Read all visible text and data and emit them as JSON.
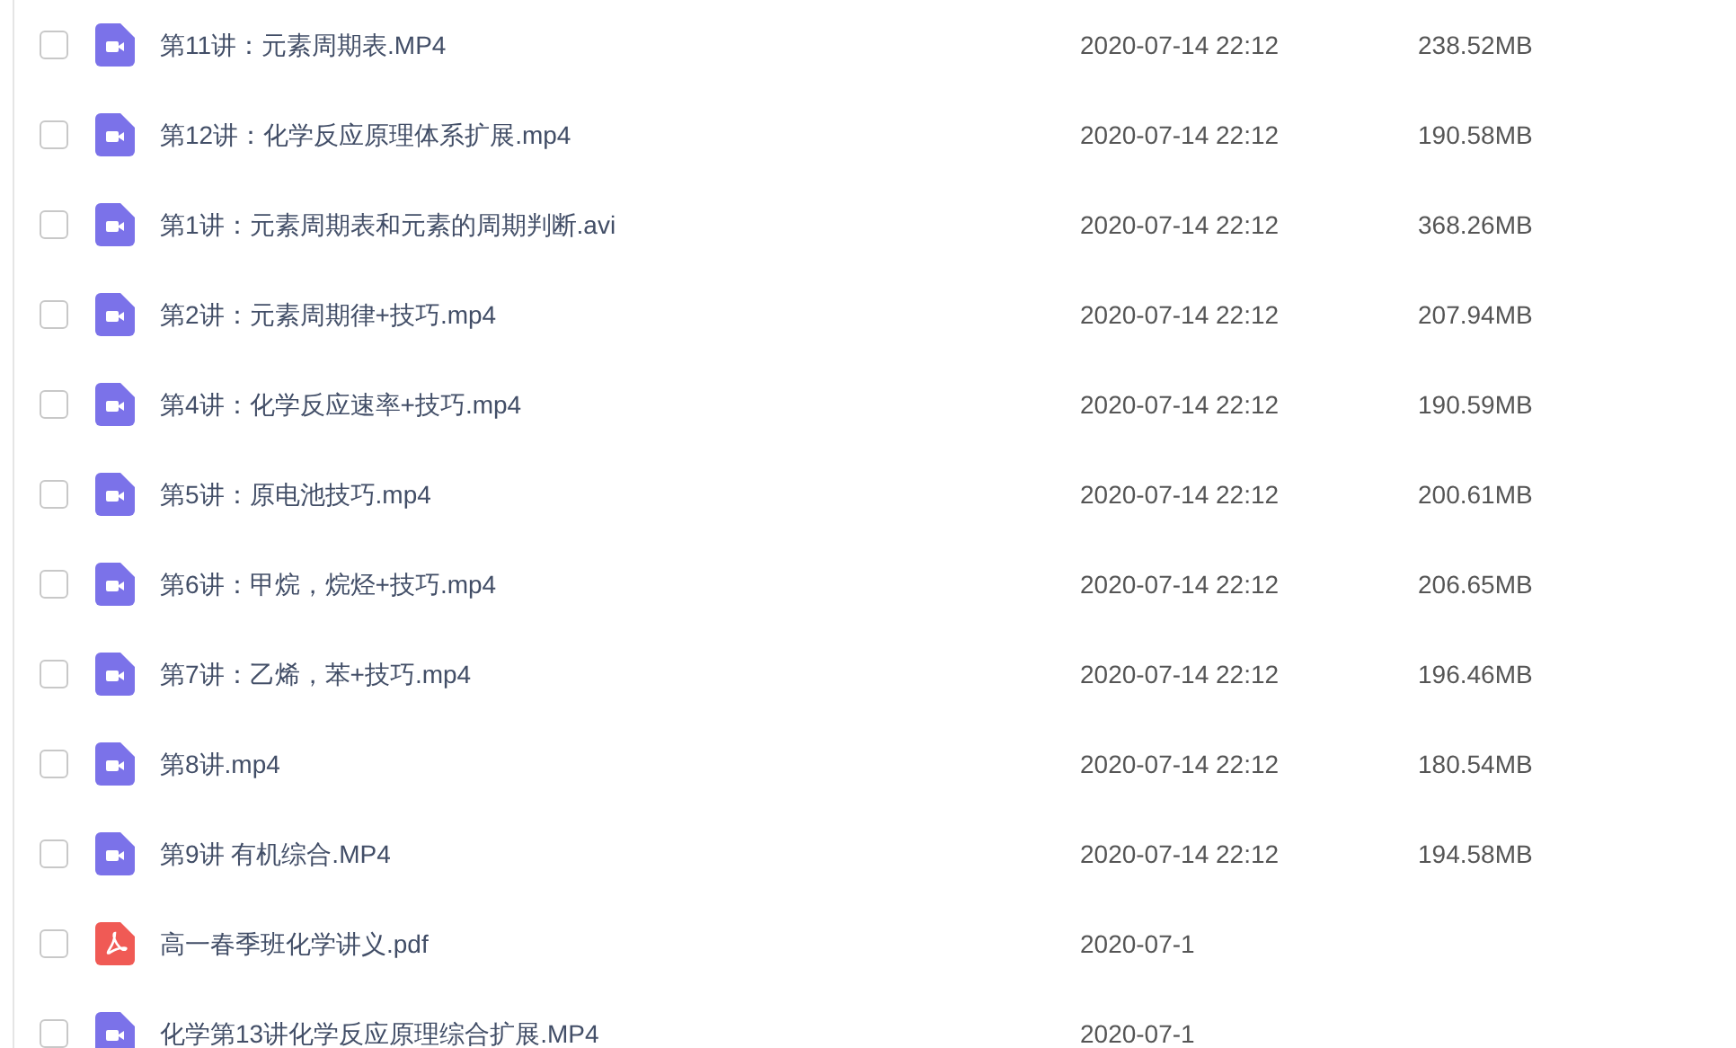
{
  "files": [
    {
      "kind": "video",
      "name": "第11讲：元素周期表.MP4",
      "date": "2020-07-14 22:12",
      "size": "238.52MB",
      "selected": false
    },
    {
      "kind": "video",
      "name": "第12讲：化学反应原理体系扩展.mp4",
      "date": "2020-07-14 22:12",
      "size": "190.58MB",
      "selected": false
    },
    {
      "kind": "video",
      "name": "第1讲：元素周期表和元素的周期判断.avi",
      "date": "2020-07-14 22:12",
      "size": "368.26MB",
      "selected": false
    },
    {
      "kind": "video",
      "name": "第2讲：元素周期律+技巧.mp4",
      "date": "2020-07-14 22:12",
      "size": "207.94MB",
      "selected": false
    },
    {
      "kind": "video",
      "name": "第4讲：化学反应速率+技巧.mp4",
      "date": "2020-07-14 22:12",
      "size": "190.59MB",
      "selected": false
    },
    {
      "kind": "video",
      "name": "第5讲：原电池技巧.mp4",
      "date": "2020-07-14 22:12",
      "size": "200.61MB",
      "selected": false
    },
    {
      "kind": "video",
      "name": "第6讲：甲烷，烷烃+技巧.mp4",
      "date": "2020-07-14 22:12",
      "size": "206.65MB",
      "selected": false
    },
    {
      "kind": "video",
      "name": "第7讲：乙烯，苯+技巧.mp4",
      "date": "2020-07-14 22:12",
      "size": "196.46MB",
      "selected": false
    },
    {
      "kind": "video",
      "name": "第8讲.mp4",
      "date": "2020-07-14 22:12",
      "size": "180.54MB",
      "selected": false
    },
    {
      "kind": "video",
      "name": "第9讲 有机综合.MP4",
      "date": "2020-07-14 22:12",
      "size": "194.58MB",
      "selected": false
    },
    {
      "kind": "pdf",
      "name": "高一春季班化学讲义.pdf",
      "date": "2020-07-1",
      "selected": false
    },
    {
      "kind": "video",
      "name": "化学第13讲化学反应原理综合扩展.MP4",
      "date": "2020-07-1",
      "selected": false
    }
  ]
}
